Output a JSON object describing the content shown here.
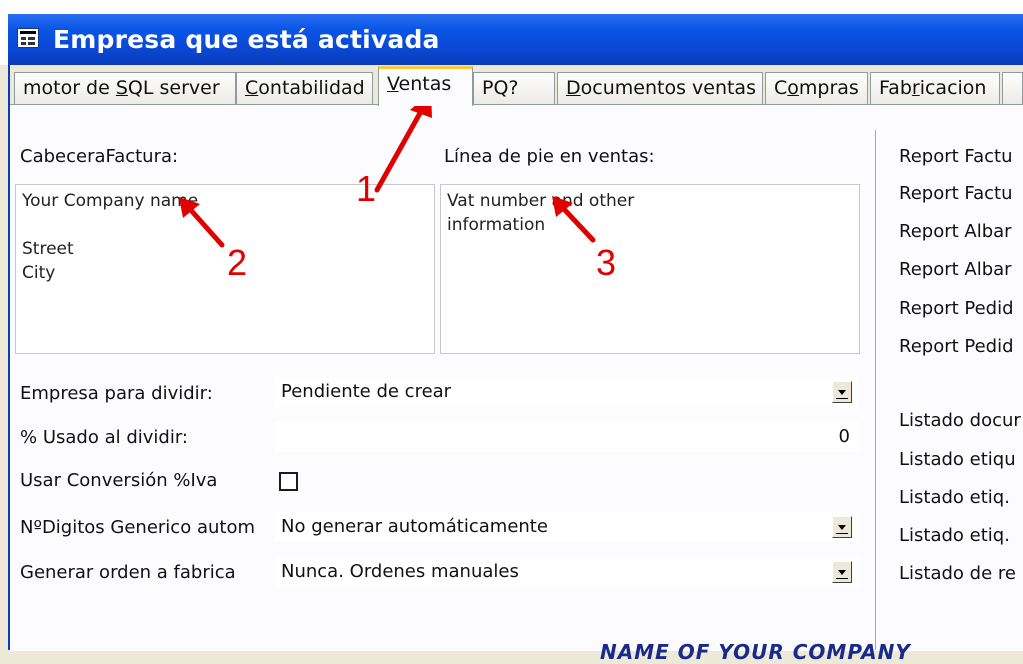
{
  "window": {
    "title": "Empresa que está activada",
    "icon": "form-window-icon"
  },
  "tabs": [
    {
      "label": "motor de SQL server",
      "accel": "S",
      "pre": "motor de ",
      "post": "QL server"
    },
    {
      "label": "Contabilidad",
      "accel": "C",
      "pre": "",
      "post": "ontabilidad"
    },
    {
      "label": "Ventas",
      "accel": "V",
      "pre": "",
      "post": "entas",
      "active": true
    },
    {
      "label": "PQ?",
      "pre": "PQ?"
    },
    {
      "label": "Documentos ventas",
      "accel": "D",
      "pre": "",
      "post": "ocumentos ventas"
    },
    {
      "label": "Compras",
      "accel": "o",
      "pre": "C",
      "post": "mpras"
    },
    {
      "label": "Fabricacion",
      "accel": "r",
      "pre": "Fab",
      "post": "icacion"
    }
  ],
  "ventas": {
    "cabecera_label": "CabeceraFactura:",
    "cabecera_value": "Your Company name\n\nStreet\nCity",
    "pie_label": "Línea de pie en ventas:",
    "pie_value": "Vat number and other\ninformation",
    "empresa_dividir_label": "Empresa para dividir:",
    "empresa_dividir_value": "Pendiente de crear",
    "usado_dividir_label": "% Usado al dividir:",
    "usado_dividir_value": "0",
    "conversion_label": "Usar Conversión %Iva",
    "conversion_checked": false,
    "digitos_label": "NºDigitos Generico autom",
    "digitos_value": "No generar automáticamente",
    "orden_label": "Generar orden a fabrica",
    "orden_value": "Nunca. Ordenes manuales"
  },
  "right_column": {
    "reports": [
      "Report Factu",
      "Report Factu",
      "Report Albar",
      "Report Albar",
      "Report Pedid",
      "Report Pedid"
    ],
    "listados": [
      "Listado docur",
      "Listado etiqu",
      "Listado etiq.",
      "Listado etiq.",
      "Listado de re"
    ]
  },
  "footer_text": "NAME OF YOUR COMPANY",
  "annotations": {
    "n1": "1",
    "n2": "2",
    "n3": "3",
    "color": "#e00000"
  }
}
